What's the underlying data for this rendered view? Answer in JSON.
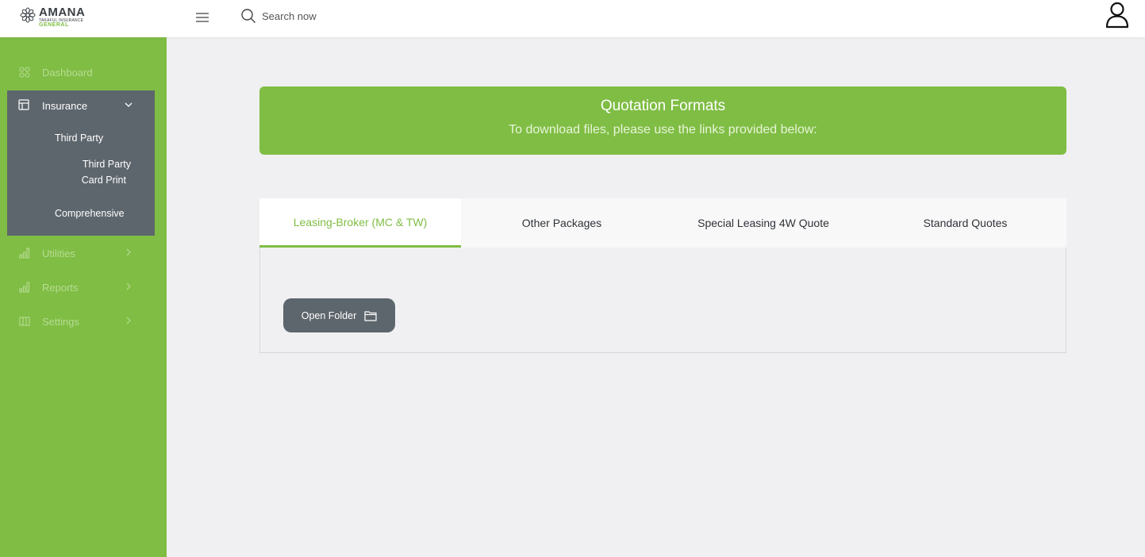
{
  "brand": {
    "name": "AMANA",
    "tagline": "TAKAFUL INSURANCE",
    "division": "GENERAL"
  },
  "header": {
    "search_placeholder": "Search now"
  },
  "sidebar": {
    "items": [
      {
        "label": "Dashboard",
        "icon": "grid-icon"
      },
      {
        "label": "Insurance",
        "icon": "layout-icon",
        "expanded": true
      },
      {
        "label": "Utilities",
        "icon": "bar-chart-icon"
      },
      {
        "label": "Reports",
        "icon": "bar-chart-icon"
      },
      {
        "label": "Settings",
        "icon": "columns-icon"
      }
    ],
    "insurance_sub": {
      "third_party": "Third Party",
      "third_party_card_line1": "Third Party",
      "third_party_card_line2": "Card Print",
      "comprehensive": "Comprehensive"
    }
  },
  "banner": {
    "title": "Quotation Formats",
    "subtitle": "To download files, please use the links provided below:"
  },
  "tabs": [
    {
      "label": "Leasing-Broker (MC & TW)",
      "active": true
    },
    {
      "label": "Other Packages",
      "active": false
    },
    {
      "label": "Special Leasing 4W Quote",
      "active": false
    },
    {
      "label": "Standard Quotes",
      "active": false
    }
  ],
  "panel": {
    "open_folder_label": "Open Folder"
  },
  "colors": {
    "accent_green": "#7fbd44",
    "dark_slate": "#5e666d",
    "background": "#f0f0f2"
  }
}
